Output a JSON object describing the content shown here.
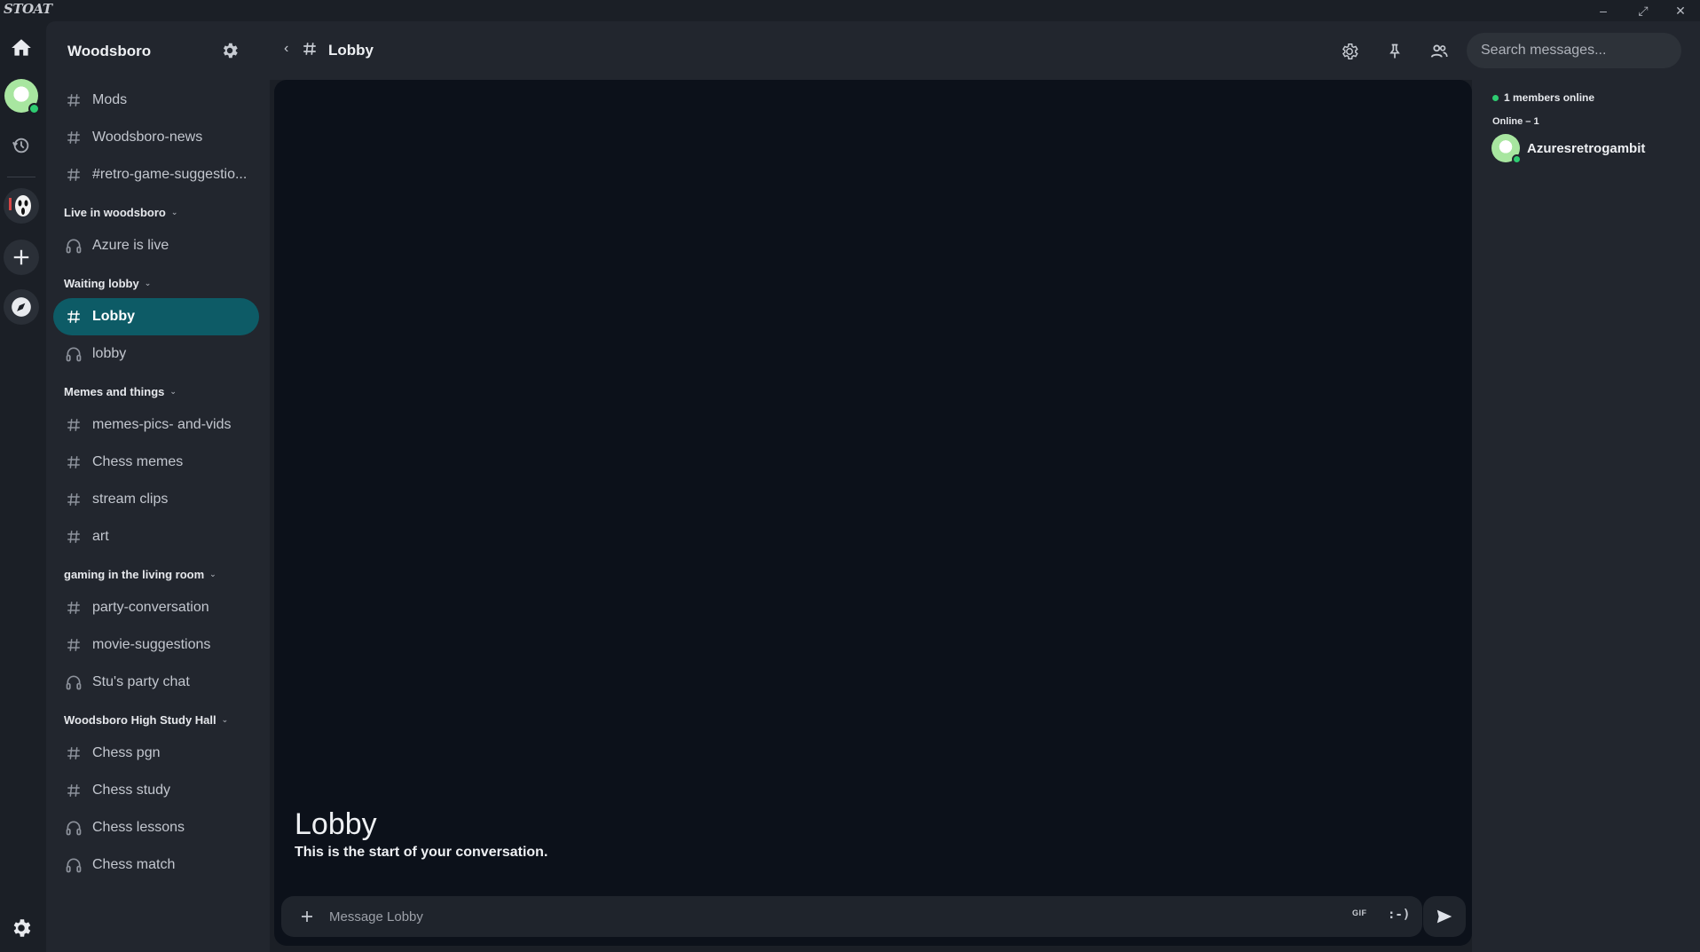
{
  "app": {
    "logo_text": "STOAT"
  },
  "colors": {
    "accent": "#0d5b66",
    "online": "#2ecc71",
    "chat_bg": "#0c111a",
    "sidebar_bg": "#22262e"
  },
  "rail": {
    "items": [
      {
        "name": "home",
        "icon": "home-icon"
      },
      {
        "name": "profile-avatar",
        "icon": "avatar"
      },
      {
        "name": "history",
        "icon": "history-icon"
      },
      {
        "name": "server-woodsboro",
        "icon": "ghostface-icon"
      },
      {
        "name": "add-server",
        "icon": "plus-icon"
      },
      {
        "name": "discover",
        "icon": "compass-icon"
      },
      {
        "name": "settings",
        "icon": "gear-icon"
      }
    ]
  },
  "server": {
    "name": "Woodsboro"
  },
  "channels": {
    "top": [
      {
        "label": "Mods",
        "type": "text"
      },
      {
        "label": "Woodsboro-news",
        "type": "text"
      },
      {
        "label": "#retro-game-suggestio...",
        "type": "text"
      }
    ],
    "categories": [
      {
        "label": "Live in woodsboro",
        "items": [
          {
            "label": "Azure is live",
            "type": "voice"
          }
        ]
      },
      {
        "label": "Waiting lobby",
        "items": [
          {
            "label": "Lobby",
            "type": "text",
            "active": true
          },
          {
            "label": "lobby",
            "type": "voice"
          }
        ]
      },
      {
        "label": "Memes and things",
        "items": [
          {
            "label": "memes-pics- and-vids",
            "type": "text"
          },
          {
            "label": "Chess memes",
            "type": "text"
          },
          {
            "label": "stream clips",
            "type": "text"
          },
          {
            "label": "art",
            "type": "text"
          }
        ]
      },
      {
        "label": "gaming in the living room",
        "items": [
          {
            "label": "party-conversation",
            "type": "text"
          },
          {
            "label": "movie-suggestions",
            "type": "text"
          },
          {
            "label": "Stu's party chat",
            "type": "voice"
          }
        ]
      },
      {
        "label": "Woodsboro High Study Hall",
        "items": [
          {
            "label": "Chess pgn",
            "type": "text"
          },
          {
            "label": "Chess study",
            "type": "text"
          },
          {
            "label": "Chess lessons",
            "type": "voice"
          },
          {
            "label": "Chess match",
            "type": "voice"
          }
        ]
      }
    ]
  },
  "header": {
    "channel_title": "Lobby",
    "search_placeholder": "Search messages..."
  },
  "chat": {
    "intro_title": "Lobby",
    "intro_sub": "This is the start of your conversation.",
    "composer_placeholder": "Message Lobby",
    "gif_label": "GIF",
    "emoji_label": ":-)"
  },
  "members": {
    "online_count": "1 members online",
    "online_label": "Online – 1",
    "list": [
      {
        "name": "Azuresretrogambit"
      }
    ]
  },
  "window": {
    "minimize": "–",
    "maximize": "⤢",
    "close": "✕"
  }
}
